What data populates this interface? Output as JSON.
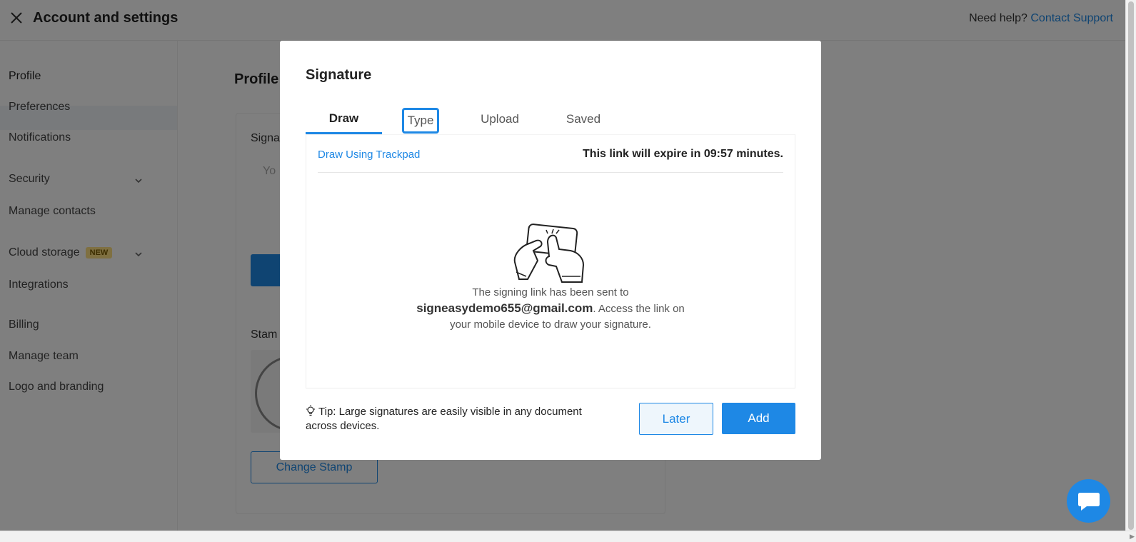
{
  "header": {
    "title": "Account and settings",
    "help_text": "Need help?",
    "help_link": "Contact Support"
  },
  "sidebar": {
    "items": [
      {
        "label": "Profile"
      },
      {
        "label": "Preferences"
      },
      {
        "label": "Notifications"
      },
      {
        "label": "Security"
      },
      {
        "label": "Manage contacts"
      },
      {
        "label": "Cloud storage",
        "badge": "NEW"
      },
      {
        "label": "Integrations"
      },
      {
        "label": "Billing"
      },
      {
        "label": "Manage team"
      },
      {
        "label": "Logo and branding"
      }
    ]
  },
  "main": {
    "title": "Profile",
    "signature_label": "Signa",
    "signature_placeholder": "Yo",
    "stamp_label": "Stam",
    "change_stamp": "Change Stamp"
  },
  "modal": {
    "title": "Signature",
    "tabs": [
      {
        "label": "Draw"
      },
      {
        "label": "Type"
      },
      {
        "label": "Upload"
      },
      {
        "label": "Saved"
      }
    ],
    "draw_link": "Draw Using Trackpad",
    "expiry": "This link will expire in 09:57 minutes.",
    "message_before": "The signing link has been sent to",
    "email": "signeasydemo655@gmail.com",
    "message_after": ". Access the link on your mobile device to draw your signature.",
    "tip": "Tip: Large signatures are easily visible in any document across devices.",
    "later_label": "Later",
    "add_label": "Add"
  },
  "colors": {
    "accent": "#1e88e5",
    "badge": "#ffe082"
  }
}
